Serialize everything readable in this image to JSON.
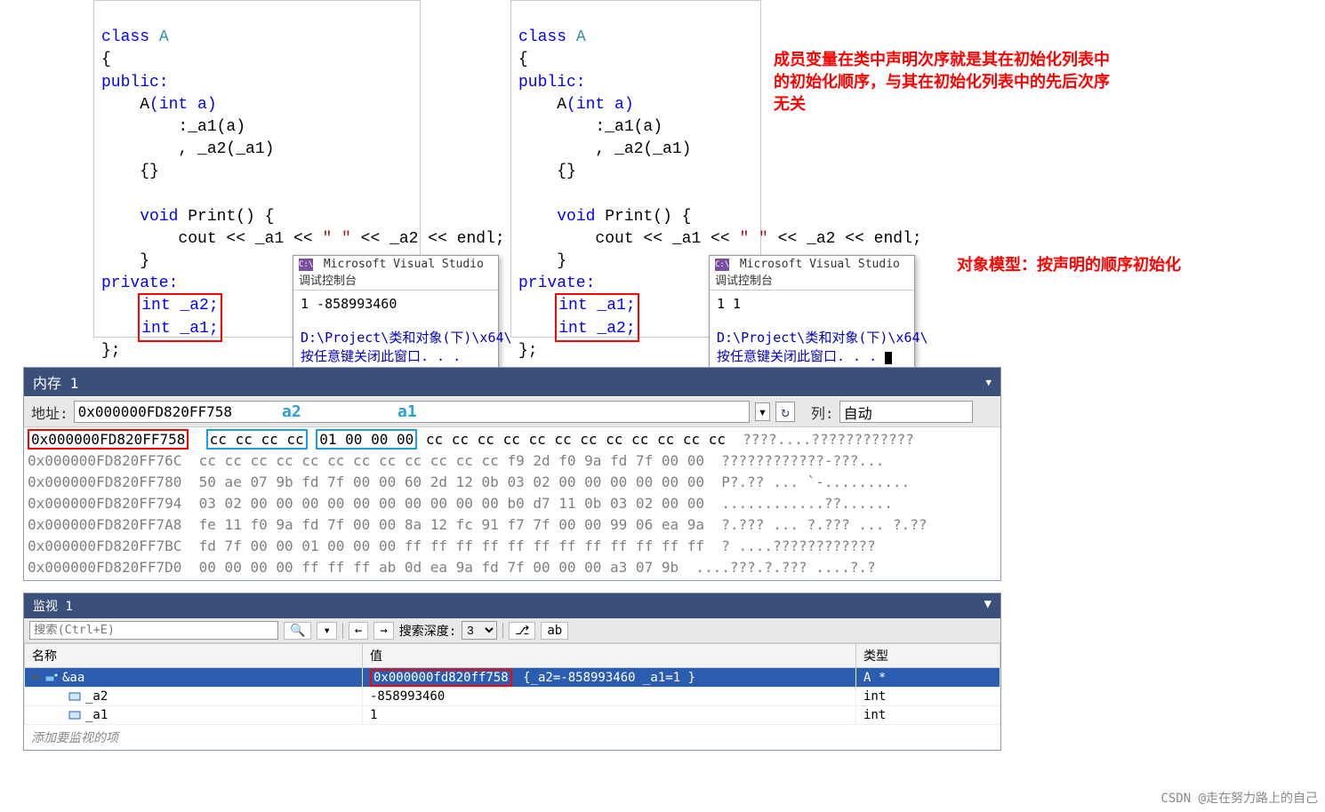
{
  "code1": {
    "lines": {
      "l0_class": "class",
      "l0_name": "A",
      "l1": "{",
      "l2": "public:",
      "l3_ctor": "A",
      "l3_sig": "(int a)",
      "l4": ":_a1(a)",
      "l5": ", _a2(_a1)",
      "l6": "{}",
      "blank": "",
      "l7_void": "void",
      "l7_fn": " Print() {",
      "l8a": "cout << _a1 << ",
      "l8s": "\" \"",
      "l8b": " << _a2 << endl;",
      "l9": "}",
      "l10": "private:",
      "l11": "int _a2;",
      "l12": "int _a1;",
      "l13": "};"
    }
  },
  "code2": {
    "lines": {
      "l0_class": "class",
      "l0_name": "A",
      "l1": "{",
      "l2": "public:",
      "l3_ctor": "A",
      "l3_sig": "(int a)",
      "l4": ":_a1(a)",
      "l5": ", _a2(_a1)",
      "l6": "{}",
      "blank": "",
      "l7_void": "void",
      "l7_fn": " Print() {",
      "l8a": "cout << _a1 << ",
      "l8s": "\" \"",
      "l8b": " << _a2 << endl;",
      "l9": "}",
      "l10": "private:",
      "l11": "int _a1;",
      "l12": "int _a2;",
      "l13": "};"
    }
  },
  "console1": {
    "title": "Microsoft Visual Studio 调试控制台",
    "out": "1 -858993460",
    "path": "D:\\Project\\类和对象(下)\\x64\\",
    "hint": "按任意键关闭此窗口. . ."
  },
  "console2": {
    "title": "Microsoft Visual Studio 调试控制台",
    "out": "1 1",
    "path": "D:\\Project\\类和对象(下)\\x64\\",
    "hint": "按任意键关闭此窗口. . ."
  },
  "anno1": "成员变量在类中声明次序就是其在初始化列表中的初始化顺序，与其在初始化列表中的先后次序无关",
  "anno2": "对象模型：按声明的顺序初始化",
  "memory": {
    "title": "内存 1",
    "addr_label": "地址:",
    "addr_value": "0x000000FD820FF758",
    "refresh_glyph": "↻",
    "col_label": "列:",
    "col_value": "自动",
    "label_a2": "a2",
    "label_a1": "a1",
    "rows": [
      {
        "addr": "0x000000FD820FF758",
        "a2": "cc cc cc cc",
        "a1": "01 00 00 00",
        "rest": " cc cc cc cc cc cc cc cc cc cc cc cc",
        "ascii": "  ????....????????????"
      },
      {
        "addr": "0x000000FD820FF76C",
        "hex": "cc cc cc cc cc cc cc cc cc cc cc cc f9 2d f0 9a fd 7f 00 00",
        "ascii": "  ????????????-???..."
      },
      {
        "addr": "0x000000FD820FF780",
        "hex": "50 ae 07 9b fd 7f 00 00 60 2d 12 0b 03 02 00 00 00 00 00 00",
        "ascii": "  P?.?? ... `-.........."
      },
      {
        "addr": "0x000000FD820FF794",
        "hex": "03 02 00 00 00 00 00 00 00 00 00 00 b0 d7 11 0b 03 02 00 00",
        "ascii": "  ............??......"
      },
      {
        "addr": "0x000000FD820FF7A8",
        "hex": "fe 11 f0 9a fd 7f 00 00 8a 12 fc 91 f7 7f 00 00 99 06 ea 9a",
        "ascii": "  ?.??? ... ?.??? ... ?.??"
      },
      {
        "addr": "0x000000FD820FF7BC",
        "hex": "fd 7f 00 00 01 00 00 00 ff ff ff ff ff ff ff ff ff ff ff ff",
        "ascii": "  ? ....????????????"
      },
      {
        "addr": "0x000000FD820FF7D0",
        "hex": "00 00 00 00 ff ff ff ab 0d ea 9a fd 7f 00 00 00 a3 07 9b",
        "ascii": "  ....???.?.??? ....?.?"
      }
    ]
  },
  "watch": {
    "title": "监视 1",
    "search_placeholder": "搜索(Ctrl+E)",
    "depth_label": "搜索深度:",
    "depth_value": "3",
    "col_name": "名称",
    "col_value": "值",
    "col_type": "类型",
    "row0": {
      "name": "&aa",
      "addr": "0x000000fd820ff758",
      "rest": " {_a2=-858993460 _a1=1 }",
      "type": "A *"
    },
    "row1": {
      "name": "_a2",
      "value": "-858993460",
      "type": "int"
    },
    "row2": {
      "name": "_a1",
      "value": "1",
      "type": "int"
    },
    "add_hint": "添加要监视的项"
  },
  "watermark": "CSDN @走在努力路上的自己"
}
